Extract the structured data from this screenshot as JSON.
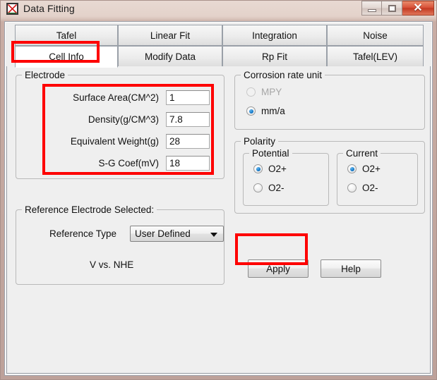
{
  "window": {
    "title": "Data Fitting",
    "icon": "plot-x-icon",
    "controls": {
      "minimize": "minimize-icon",
      "maximize": "maximize-icon",
      "close": "✕"
    }
  },
  "tabs": {
    "row1": [
      {
        "label": "Tafel",
        "active": false
      },
      {
        "label": "Linear Fit",
        "active": false
      },
      {
        "label": "Integration",
        "active": false
      },
      {
        "label": "Noise",
        "active": false
      }
    ],
    "row2": [
      {
        "label": "Cell Info",
        "active": true
      },
      {
        "label": "Modify Data",
        "active": false
      },
      {
        "label": "Rp Fit",
        "active": false
      },
      {
        "label": "Tafel(LEV)",
        "active": false
      }
    ]
  },
  "electrode": {
    "legend": "Electrode",
    "fields": [
      {
        "label": "Surface Area(CM^2)",
        "value": "1"
      },
      {
        "label": "Density(g/CM^3)",
        "value": "7.8"
      },
      {
        "label": "Equivalent Weight(g)",
        "value": "28"
      },
      {
        "label": "S-G Coef(mV)",
        "value": "18"
      }
    ]
  },
  "corrosion_rate_unit": {
    "legend": "Corrosion rate unit",
    "options": [
      {
        "label": "MPY",
        "selected": false,
        "disabled": true
      },
      {
        "label": "mm/a",
        "selected": true,
        "disabled": false
      }
    ]
  },
  "polarity": {
    "legend": "Polarity",
    "potential": {
      "legend": "Potential",
      "options": [
        {
          "label": "O2+",
          "selected": true
        },
        {
          "label": "O2-",
          "selected": false
        }
      ]
    },
    "current": {
      "legend": "Current",
      "options": [
        {
          "label": "O2+",
          "selected": true
        },
        {
          "label": "O2-",
          "selected": false
        }
      ]
    }
  },
  "reference_electrode": {
    "legend": "Reference Electrode Selected:",
    "type_label": "Reference Type",
    "type_value": "User Defined",
    "note": "V vs. NHE"
  },
  "actions": {
    "apply": "Apply",
    "help": "Help"
  },
  "annotations": {
    "highlight_color": "#fe0000",
    "boxes": [
      "cell-info-tab",
      "electrode-fields",
      "apply-button"
    ]
  }
}
